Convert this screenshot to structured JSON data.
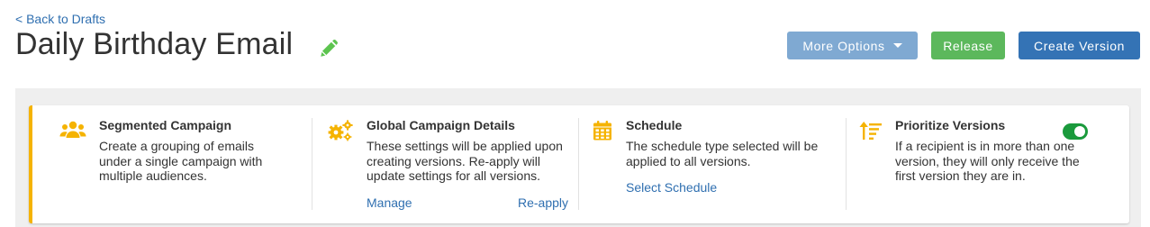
{
  "nav": {
    "back_label": "< Back to Drafts"
  },
  "header": {
    "title": "Daily Birthday Email",
    "more_options_label": "More Options",
    "release_label": "Release",
    "create_version_label": "Create Version"
  },
  "colors": {
    "accent_yellow": "#f5b301",
    "primary_blue": "#3473b5",
    "light_blue": "#7fa9d2",
    "green": "#5cb85c",
    "toggle_green": "#1a9a3c"
  },
  "cards": [
    {
      "icon": "users-icon",
      "heading": "Segmented Campaign",
      "text": "Create a grouping of emails under a single campaign with multiple audiences."
    },
    {
      "icon": "gears-icon",
      "heading": "Global Campaign Details",
      "text": "These settings will be applied upon creating versions. Re-apply will update settings for all versions.",
      "link_manage": "Manage",
      "link_reapply": "Re-apply"
    },
    {
      "icon": "calendar-icon",
      "heading": "Schedule",
      "text": "The schedule type selected will be applied to all versions.",
      "link_schedule": "Select Schedule"
    },
    {
      "icon": "sort-amount-icon",
      "heading": "Prioritize Versions",
      "text": "If a recipient is in more than one version, they will only receive the first version they are in.",
      "toggle_on": true
    }
  ]
}
